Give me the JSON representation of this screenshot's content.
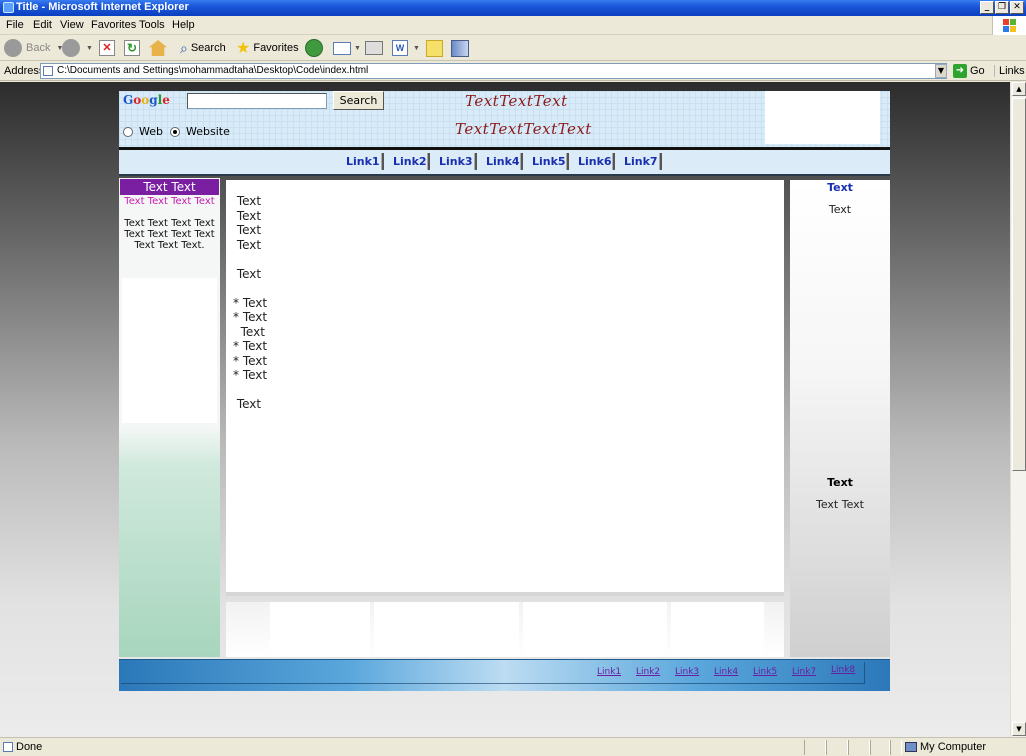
{
  "window": {
    "title": "Title - Microsoft Internet Explorer"
  },
  "menu": [
    "File",
    "Edit",
    "View",
    "Favorites",
    "Tools",
    "Help"
  ],
  "toolbar": {
    "back": "Back",
    "search": "Search",
    "favorites": "Favorites"
  },
  "address": {
    "label": "Address",
    "url": "C:\\Documents and Settings\\mohammadtaha\\Desktop\\Code\\index.html",
    "go": "Go",
    "links": "Links"
  },
  "page": {
    "google_logo": "Google",
    "search_button": "Search",
    "radio_web": "Web",
    "radio_website": "Website",
    "header_script_1": "TextTextText",
    "header_script_2": "TextTextTextText",
    "nav": [
      "Link1",
      "Link2",
      "Link3",
      "Link4",
      "Link5",
      "Link6",
      "Link7"
    ],
    "left": {
      "heading": "Text Text",
      "pink": "Text Text Text Text",
      "body": "Text Text Text Text Text Text Text Text Text Text Text."
    },
    "main_lines": [
      " Text",
      " Text",
      " Text",
      " Text",
      "",
      " Text",
      "",
      "* Text",
      "* Text",
      "  Text",
      "* Text",
      "* Text",
      "* Text",
      "",
      " Text"
    ],
    "right": {
      "title1": "Text",
      "text1": "Text",
      "title2": "Text",
      "text2": "Text Text"
    },
    "footer_links": [
      "Link1",
      "Link2",
      "Link3",
      "Link4",
      "Link5",
      "Link7",
      "Link8"
    ]
  },
  "status": {
    "text": "Done",
    "zone": "My Computer"
  }
}
